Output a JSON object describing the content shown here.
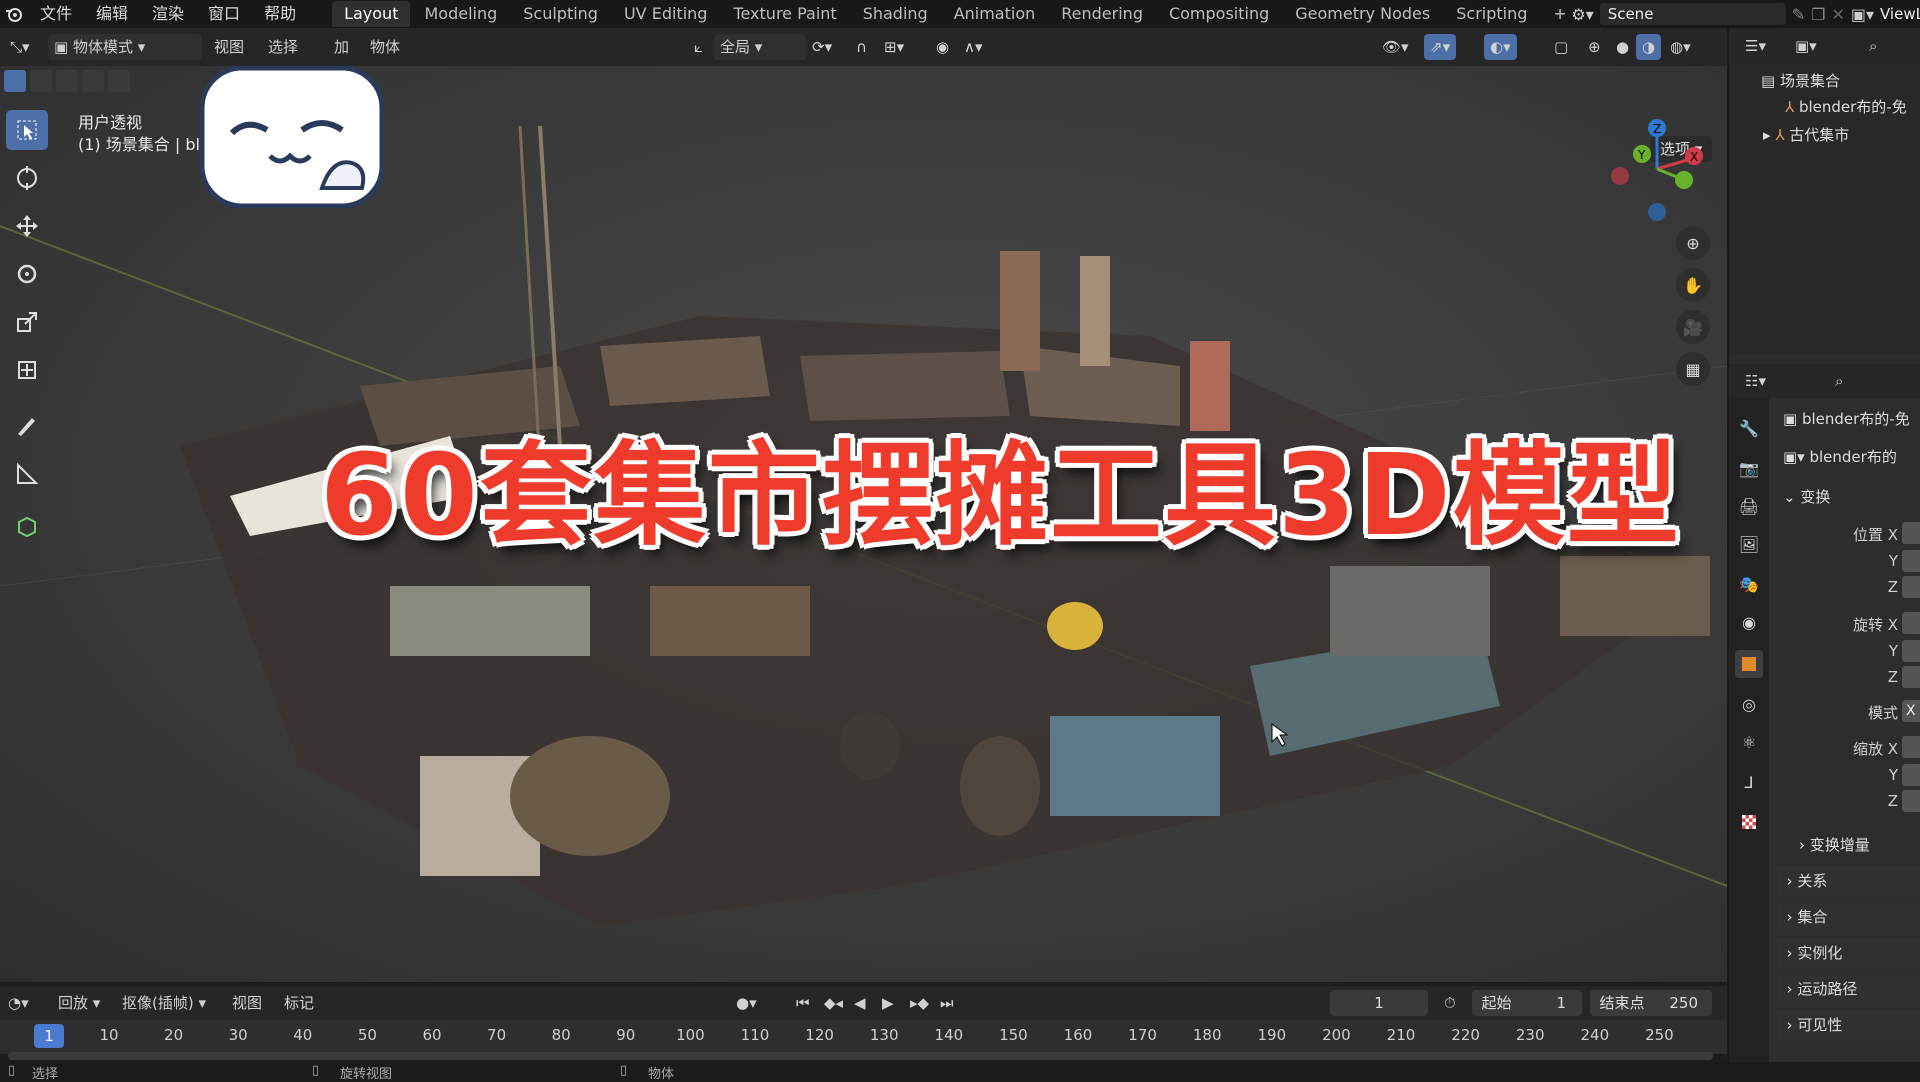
{
  "menu": [
    "文件",
    "编辑",
    "渲染",
    "窗口",
    "帮助"
  ],
  "workspaces": [
    "Layout",
    "Modeling",
    "Sculpting",
    "UV Editing",
    "Texture Paint",
    "Shading",
    "Animation",
    "Rendering",
    "Compositing",
    "Geometry Nodes",
    "Scripting"
  ],
  "active_workspace": "Layout",
  "scene_name": "Scene",
  "view_layer": "ViewLa",
  "viewport_header": {
    "mode": "物体模式",
    "view": "视图",
    "select": "选择",
    "add": "加",
    "object": "物体",
    "transform_orientation": "全局",
    "options": "选项"
  },
  "viewport_overlay": {
    "line1": "用户透视",
    "line2": "(1) 场景集合 | bl"
  },
  "big_title": "60套集市摆摊工具3D模型",
  "outliner": {
    "root": "场景集合",
    "item1": "blender布的-免",
    "item2": "古代集市"
  },
  "properties": {
    "object_name": "blender布的-免",
    "data_name": "blender布的",
    "transform_section": "变换",
    "location_x": "位置 X",
    "y": "Y",
    "z": "Z",
    "rotation_x": "旋转 X",
    "mode_label": "模式",
    "mode_value": "X",
    "scale_x": "缩放 X",
    "delta_transform": "变换增量",
    "sections": [
      "关系",
      "集合",
      "实例化",
      "运动路径",
      "可见性"
    ]
  },
  "timeline": {
    "playback": "回放",
    "keying": "抠像(插帧)",
    "view": "视图",
    "marker": "标记",
    "current_frame": "1",
    "start_label": "起始",
    "start_value": "1",
    "end_label": "结束点",
    "end_value": "250",
    "ticks": [
      "10",
      "20",
      "30",
      "40",
      "50",
      "60",
      "70",
      "80",
      "90",
      "100",
      "110",
      "120",
      "130",
      "140",
      "150",
      "160",
      "170",
      "180",
      "190",
      "200",
      "210",
      "220",
      "230",
      "240",
      "250"
    ],
    "playhead_label": "1"
  },
  "statusbar": {
    "select": "选择",
    "rotate_view": "旋转视图",
    "object": "物体"
  },
  "colors": {
    "accent": "#4b6fa6",
    "title_red": "#ef3b2c",
    "playhead": "#4a7bd0"
  }
}
